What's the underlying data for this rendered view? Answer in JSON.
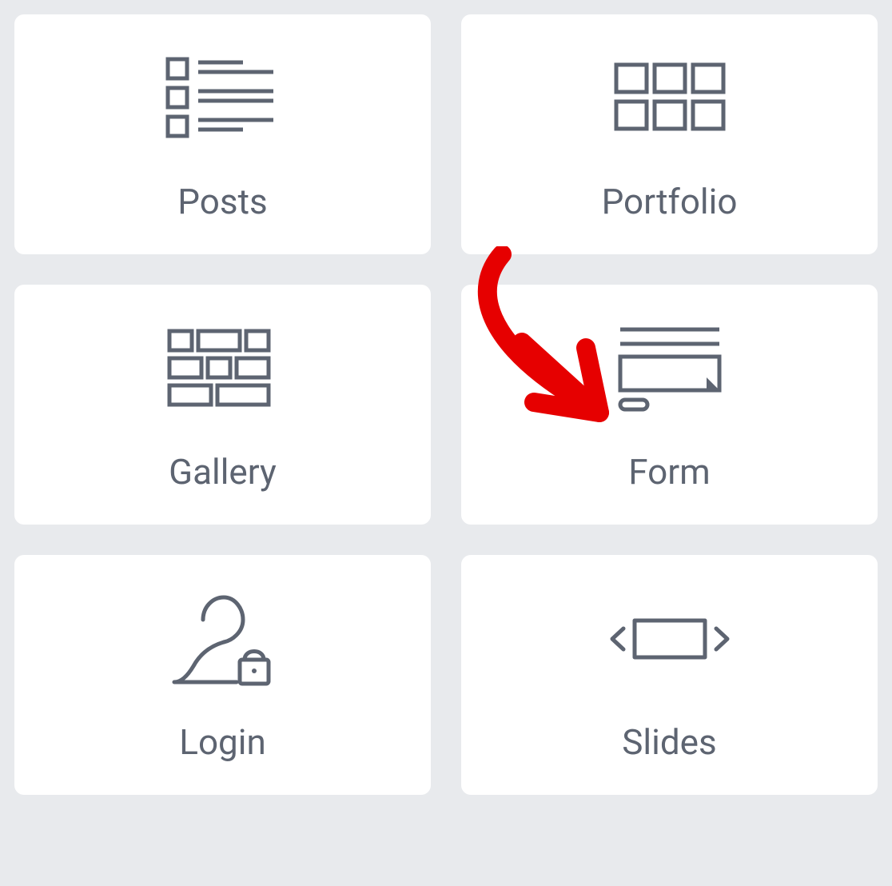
{
  "cards": [
    {
      "label": "Posts",
      "icon": "posts-icon"
    },
    {
      "label": "Portfolio",
      "icon": "portfolio-icon"
    },
    {
      "label": "Gallery",
      "icon": "gallery-icon"
    },
    {
      "label": "Form",
      "icon": "form-icon"
    },
    {
      "label": "Login",
      "icon": "login-icon"
    },
    {
      "label": "Slides",
      "icon": "slides-icon"
    }
  ],
  "annotation": {
    "type": "arrow",
    "color": "#e60000",
    "target": "form"
  }
}
